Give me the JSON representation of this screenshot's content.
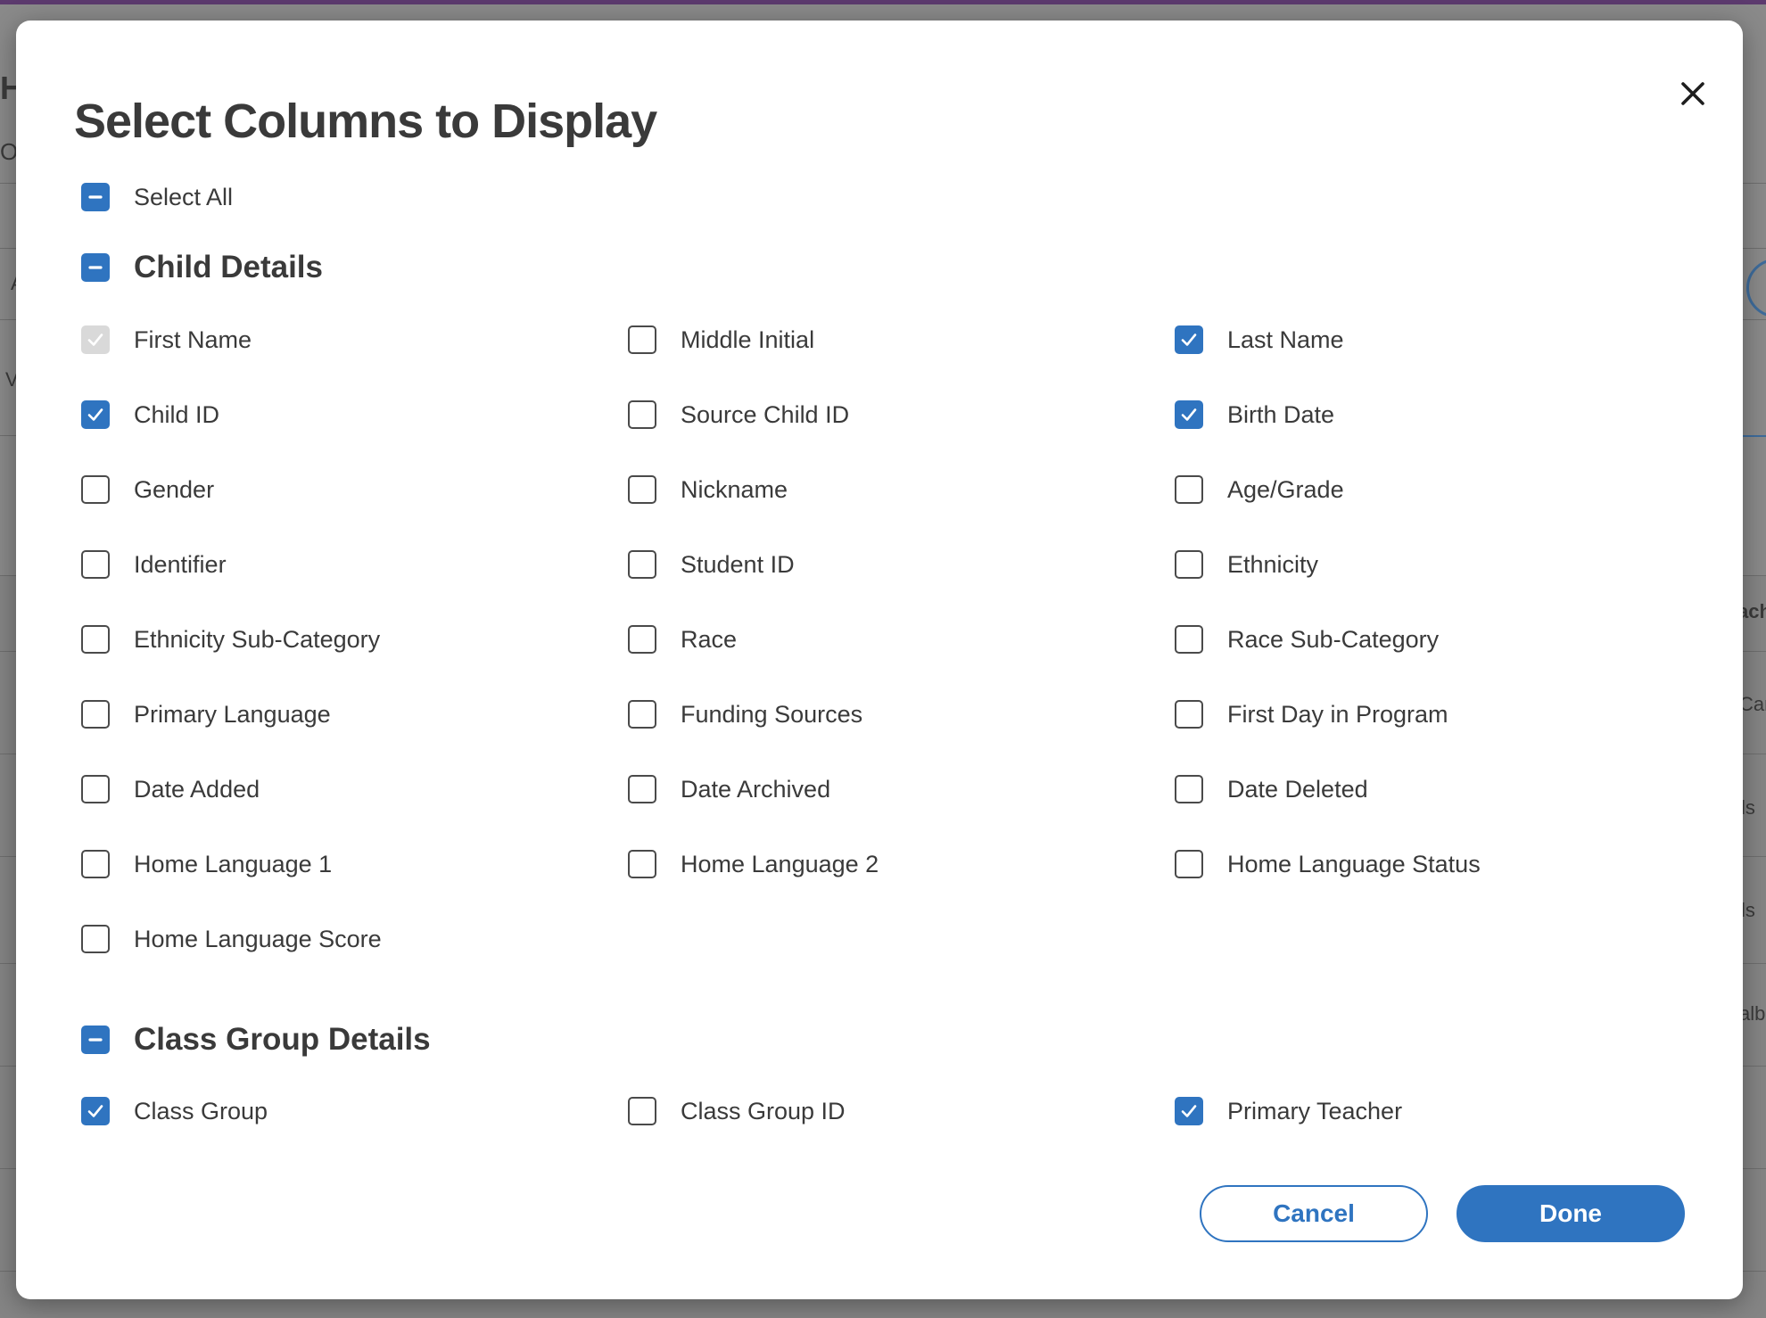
{
  "modal": {
    "title": "Select Columns to Display",
    "select_all": {
      "label": "Select All",
      "state": "indeterminate"
    },
    "sections": [
      {
        "title": "Child Details",
        "state": "indeterminate",
        "items": [
          {
            "label": "First Name",
            "state": "disabled-checked"
          },
          {
            "label": "Middle Initial",
            "state": "unchecked"
          },
          {
            "label": "Last Name",
            "state": "checked"
          },
          {
            "label": "Child ID",
            "state": "checked"
          },
          {
            "label": "Source Child ID",
            "state": "unchecked"
          },
          {
            "label": "Birth Date",
            "state": "checked"
          },
          {
            "label": "Gender",
            "state": "unchecked"
          },
          {
            "label": "Nickname",
            "state": "unchecked"
          },
          {
            "label": "Age/Grade",
            "state": "unchecked"
          },
          {
            "label": "Identifier",
            "state": "unchecked"
          },
          {
            "label": "Student ID",
            "state": "unchecked"
          },
          {
            "label": "Ethnicity",
            "state": "unchecked"
          },
          {
            "label": "Ethnicity Sub-Category",
            "state": "unchecked"
          },
          {
            "label": "Race",
            "state": "unchecked"
          },
          {
            "label": "Race Sub-Category",
            "state": "unchecked"
          },
          {
            "label": "Primary Language",
            "state": "unchecked"
          },
          {
            "label": "Funding Sources",
            "state": "unchecked"
          },
          {
            "label": "First Day in Program",
            "state": "unchecked"
          },
          {
            "label": "Date Added",
            "state": "unchecked"
          },
          {
            "label": "Date Archived",
            "state": "unchecked"
          },
          {
            "label": "Date Deleted",
            "state": "unchecked"
          },
          {
            "label": "Home Language 1",
            "state": "unchecked"
          },
          {
            "label": "Home Language 2",
            "state": "unchecked"
          },
          {
            "label": "Home Language Status",
            "state": "unchecked"
          },
          {
            "label": "Home Language Score",
            "state": "unchecked"
          }
        ]
      },
      {
        "title": "Class Group Details",
        "state": "indeterminate",
        "items": [
          {
            "label": "Class Group",
            "state": "checked"
          },
          {
            "label": "Class Group ID",
            "state": "unchecked"
          },
          {
            "label": "Primary Teacher",
            "state": "checked"
          }
        ]
      }
    ],
    "cancel_label": "Cancel",
    "done_label": "Done"
  },
  "background": {
    "fragments": [
      "Ha",
      "Ov",
      "A",
      "V",
      "ach",
      "Care",
      "ls",
      "ls",
      "albu"
    ]
  },
  "colors": {
    "accent": "#2f74c0",
    "text": "#3a3a3a",
    "disabled": "#d9d9d9",
    "overlay": "#858585"
  },
  "icons": {
    "close": "close-icon",
    "check": "check-icon",
    "minus": "minus-icon"
  }
}
